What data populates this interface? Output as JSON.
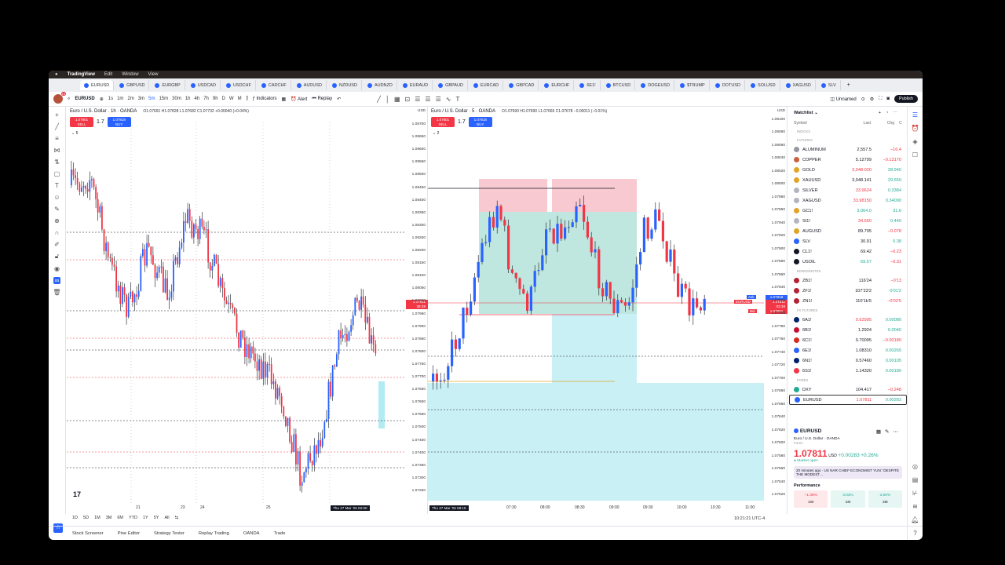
{
  "menubar": {
    "app": "TradingView",
    "items": [
      "Edit",
      "Window",
      "View"
    ]
  },
  "tabs": [
    "EURUSD",
    "GBPUSD",
    "EURGBP",
    "USDCAD",
    "USDCHF",
    "CADCHF",
    "AUDUSD",
    "NZDUSD",
    "AUDNZD",
    "EURAUD",
    "GBPAUD",
    "EURCAD",
    "GBPCAD",
    "EURCHF",
    "6E1!",
    "BTCUSD",
    "DOGEUSD",
    "$TRUMP",
    "DOTUSD",
    "SOLUSD",
    "XAGUSD",
    "SLV"
  ],
  "toolbar": {
    "avatar_badge": "10",
    "symbol": "EURUSD",
    "intervals": [
      "1s",
      "1m",
      "2m",
      "3m",
      "5m",
      "15m",
      "30m",
      "1h",
      "4h",
      "7h",
      "9h",
      "D",
      "W",
      "M"
    ],
    "active_interval": "5m",
    "indicators": "Indicators",
    "alert": "Alert",
    "replay": "Replay",
    "layout": "Unnamed",
    "publish": "Publish"
  },
  "left_chart": {
    "title": "Euro / U.S. Dollar · 1h · OANDA",
    "ohlc": "O1.07691 H1.07828 L1.07682 C1.07732 +0.00040 (+0.04%)",
    "sell_price": "1.07801",
    "sell": "SELL",
    "spread": "1.7",
    "buy_price": "1.07818",
    "buy": "BUY",
    "indicators_count": "5",
    "currency": "USD",
    "price_labels": [
      "1.08700",
      "1.08650",
      "1.08600",
      "1.08550",
      "1.08500",
      "1.08450",
      "1.08400",
      "1.08350",
      "1.08300",
      "1.08250",
      "1.08200",
      "1.08150",
      "1.08100",
      "1.08050",
      "1.08000",
      "1.07950",
      "1.07900",
      "1.07850",
      "1.07800",
      "1.07750",
      "1.07700",
      "1.07650",
      "1.07600",
      "1.07550",
      "1.07500",
      "1.07450",
      "1.07400",
      "1.07350",
      "1.07300",
      "1.07250"
    ],
    "x_labels": [
      "21",
      "23",
      "24",
      "25",
      "26"
    ],
    "crosshair_time": "Thu 27 Mar '25  02:00",
    "last_price": "1.07811",
    "countdown": "38:39"
  },
  "right_chart": {
    "title": "Euro / U.S. Dollar · 5 · OANDA",
    "ohlc": "O1.07690 H1.07690 L1.07665 C1.07678 −0.00011 (−0.01%)",
    "sell_price": "1.07801",
    "sell": "SELL",
    "spread": "1.7",
    "buy_price": "1.07818",
    "buy": "BUY",
    "indicators_count": "2",
    "currency": "USD",
    "price_labels": [
      "1.08100",
      "1.08080",
      "1.08060",
      "1.08040",
      "1.08020",
      "1.08000",
      "1.07980",
      "1.07960",
      "1.07940",
      "1.07920",
      "1.07900",
      "1.07880",
      "1.07860",
      "1.07840",
      "1.07820",
      "1.07800",
      "1.07780",
      "1.07760",
      "1.07740",
      "1.07720",
      "1.07700",
      "1.07680",
      "1.07660",
      "1.07640",
      "1.07620",
      "1.07600",
      "1.07580",
      "1.07560",
      "1.07540",
      "1.07520"
    ],
    "x_labels": [
      "07:30",
      "08:00",
      "08:30",
      "09:00",
      "09:30",
      "10:00",
      "10:30",
      "11:00"
    ],
    "crosshair_time": "Thu 27 Mar '25  08:15",
    "ask": "Ask",
    "ask_price": "1.07818",
    "symbol_tag": "EURUSD",
    "last_price": "1.07811",
    "countdown": "03:39",
    "bid": "Bid",
    "bid_price": "1.07801"
  },
  "timeframes": [
    "1D",
    "5D",
    "1M",
    "3M",
    "6M",
    "YTD",
    "1Y",
    "5Y",
    "All"
  ],
  "clock": "10:21:21 UTC-4",
  "bottom_tabs": [
    "Stock Screener",
    "Pine Editor",
    "Strategy Tester",
    "Replay Trading",
    "OANDA",
    "Trade"
  ],
  "watchlist": {
    "title": "Watchlist",
    "col_symbol": "Symbol",
    "col_last": "Last",
    "col_chg": "Chg",
    "col_chgp": "C",
    "sections": [
      {
        "name": "INDICES",
        "rows": []
      },
      {
        "name": "FUTURES",
        "rows": [
          {
            "s": "ALUMINUM",
            "l": "2,557.5",
            "c": "−16.4",
            "up": false,
            "lc": "n",
            "color": "#9598a1"
          },
          {
            "s": "COPPER",
            "l": "5.12799",
            "c": "−0.13170",
            "up": false,
            "lc": "n",
            "color": "#c8623e"
          },
          {
            "s": "GOLD",
            "l": "3,048.020",
            "c": "28.940",
            "up": true,
            "lc": "r",
            "color": "#e0a526"
          },
          {
            "s": "XAUUSD",
            "l": "3,048.141",
            "c": "29.650",
            "up": true,
            "lc": "n",
            "color": "#e0a526"
          },
          {
            "s": "SILVER",
            "l": "33.9624",
            "c": "0.3384",
            "up": true,
            "lc": "r",
            "color": "#b2b5be"
          },
          {
            "s": "XAGUSD",
            "l": "33.98150",
            "c": "0.34090",
            "up": true,
            "lc": "r",
            "color": "#b2b5be"
          },
          {
            "s": "GC1!",
            "l": "3,064.0",
            "c": "31.6",
            "up": true,
            "lc": "g",
            "color": "#e0a526"
          },
          {
            "s": "SI1!",
            "l": "34.660",
            "c": "0.440",
            "up": true,
            "lc": "r",
            "color": "#b2b5be"
          },
          {
            "s": "AUGUSD",
            "l": "89.705",
            "c": "−0.078",
            "up": false,
            "lc": "n",
            "color": "#e0a526"
          },
          {
            "s": "SLV",
            "l": "30.91",
            "c": "0.38",
            "up": true,
            "lc": "n",
            "color": "#2962ff"
          },
          {
            "s": "CL1!",
            "l": "69.42",
            "c": "−0.23",
            "up": false,
            "lc": "n",
            "color": "#131722"
          },
          {
            "s": "USOIL",
            "l": "69.57",
            "c": "−0.31",
            "up": false,
            "lc": "g",
            "color": "#131722"
          }
        ]
      },
      {
        "name": "BONDS/NOTES",
        "rows": [
          {
            "s": "ZB1!",
            "l": "116'24",
            "c": "−0'13",
            "up": false,
            "lc": "n",
            "color": "#b22234"
          },
          {
            "s": "ZF1!",
            "l": "107'23'2",
            "c": "0'01'2",
            "up": true,
            "lc": "n",
            "color": "#b22234"
          },
          {
            "s": "ZN1!",
            "l": "110'1b'5",
            "c": "−0'02'5",
            "up": false,
            "lc": "n",
            "color": "#b22234"
          }
        ]
      },
      {
        "name": "FX FUTURES",
        "rows": [
          {
            "s": "6A1!",
            "l": "0.62995",
            "c": "0.00080",
            "up": true,
            "lc": "r",
            "color": "#012169"
          },
          {
            "s": "6B1!",
            "l": "1.2924",
            "c": "0.0040",
            "up": true,
            "lc": "n",
            "color": "#c8102e"
          },
          {
            "s": "6C1!",
            "l": "0.70095",
            "c": "−0.00180",
            "up": false,
            "lc": "n",
            "color": "#d52b1e"
          },
          {
            "s": "6E1!",
            "l": "1.08310",
            "c": "0.00265",
            "up": true,
            "lc": "n",
            "color": "#2962ff"
          },
          {
            "s": "6N1!",
            "l": "0.57460",
            "c": "0.00105",
            "up": true,
            "lc": "n",
            "color": "#012169"
          },
          {
            "s": "6S1!",
            "l": "1.14320",
            "c": "0.00180",
            "up": true,
            "lc": "n",
            "color": "#f23645"
          }
        ]
      },
      {
        "name": "FOREX",
        "rows": [
          {
            "s": "DXY",
            "l": "104.417",
            "c": "−0.248",
            "up": false,
            "lc": "n",
            "color": "#22ab94"
          },
          {
            "s": "EURUSD",
            "l": "1.07811",
            "c": "0.00283",
            "up": true,
            "lc": "r",
            "color": "#2962ff",
            "hl": true
          }
        ]
      }
    ]
  },
  "details": {
    "symbol": "EURUSD",
    "name": "Euro / U.S. Dollar",
    "exchange": "OANDA",
    "type": "Forex",
    "price": "1.07811",
    "currency": "USD",
    "change": "+0.00283",
    "change_pct": "+0.26%",
    "status": "Market open",
    "news": "20 minutes ago · US NAR CHIEF ECONOMIST YUN: 'DESPITE THE MODEST…",
    "performance_title": "Performance",
    "performance": [
      {
        "v": "−1.08%",
        "p": "1W",
        "up": false
      },
      {
        "v": "3.03%",
        "p": "1M",
        "up": true
      },
      {
        "v": "3.50%",
        "p": "3M",
        "up": true
      }
    ]
  },
  "colors": {
    "up": "#22ab94",
    "down": "#f23645",
    "accent": "#2962ff"
  }
}
